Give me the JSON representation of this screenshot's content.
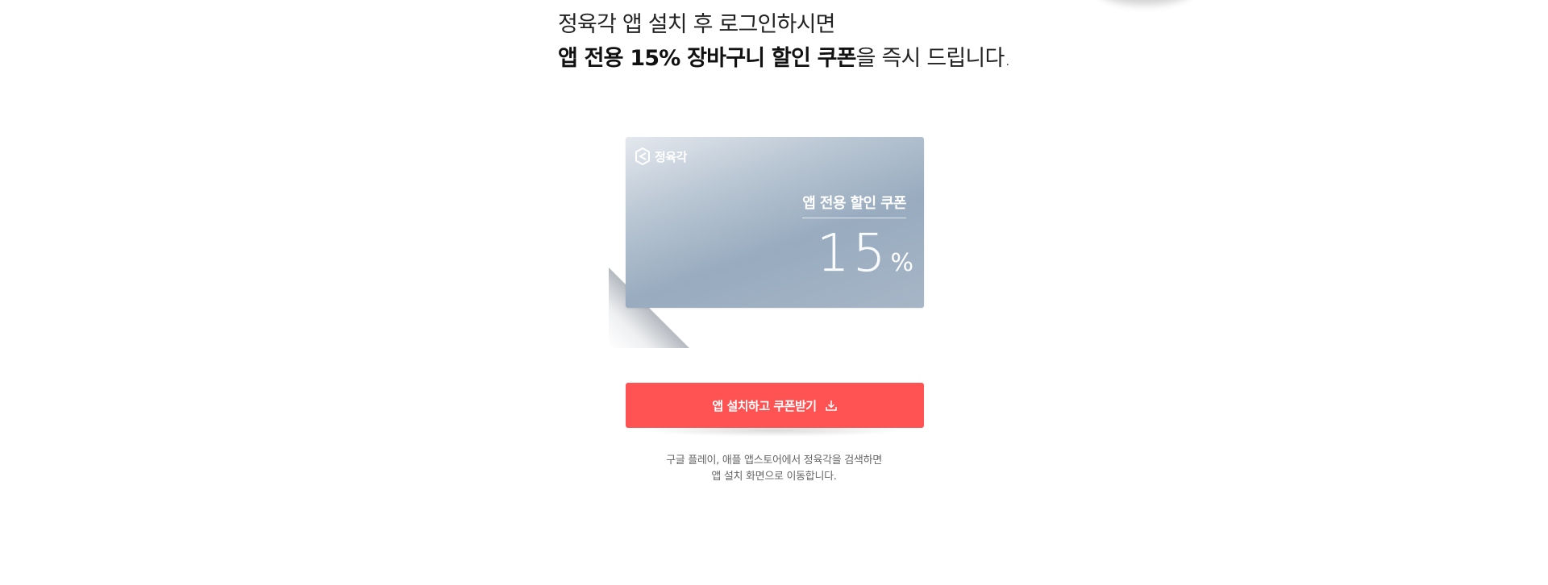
{
  "headline": {
    "line1": "정육각 앱 설치 후 로그인하시면",
    "line2_bold": "앱 전용 15% 장바구니 할인 쿠폰",
    "line2_rest": "을 즉시 드립니다."
  },
  "coupon": {
    "brand_name": "정육각",
    "brand_icon": "jeongyukgak-logo-icon",
    "label": "앱 전용 할인 쿠폰",
    "discount_value": "15",
    "discount_unit": "%",
    "card_colors": [
      "#e4e8ee",
      "#98abbf"
    ]
  },
  "cta": {
    "label": "앱 설치하고 쿠폰받기",
    "icon": "download-icon",
    "color": "#ff5252"
  },
  "note": {
    "line1": "구글 플레이, 애플 앱스토어에서 정육각을 검색하면",
    "line2": "앱 설치 화면으로 이동합니다."
  }
}
